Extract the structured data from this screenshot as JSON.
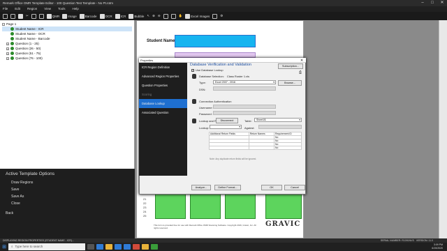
{
  "window": {
    "title": "Remark Office OMR Template Editor - 100 Question Test Template - No Pt.rotm"
  },
  "menu": [
    "File",
    "Edit",
    "Region",
    "View",
    "Tools",
    "Help"
  ],
  "toolbar": {
    "qmr": "QMR",
    "image": "Image",
    "barcode": "Barcode",
    "ocr": "OCR",
    "icr": "ICR",
    "bubble": "Bubble",
    "excel_images": "Excel Images"
  },
  "tree": {
    "root": "Page 1",
    "items": [
      {
        "label": "Student Name - ICR",
        "selected": true
      },
      {
        "label": "Student Name - OCR"
      },
      {
        "label": "Student Name - Barcode"
      },
      {
        "label": "Question (1 - 25)"
      },
      {
        "label": "Question (26 - 50)"
      },
      {
        "label": "Question (51 - 75)"
      },
      {
        "label": "Question (76 - 100)"
      }
    ]
  },
  "options": {
    "heading": "Active Template Options",
    "items": [
      "Draw Regions",
      "Save",
      "Save As",
      "Close",
      "Back"
    ]
  },
  "document": {
    "student_label": "Student Name:",
    "row_numbers": [
      "21",
      "22",
      "23",
      "24",
      "25"
    ],
    "footer": "This form is provided free for use with Remark Office OMR Scanning Software. Copyright 2016, Gravic, Inc. All rights reserved.",
    "brand": "GRAVIC"
  },
  "dialog": {
    "title": "Properties",
    "nav": [
      {
        "label": "ICR Region Definition"
      },
      {
        "label": "Advanced Region Properties"
      },
      {
        "label": "Question Properties"
      },
      {
        "label": "Scoring",
        "disabled": true
      },
      {
        "label": "Database Lookup",
        "selected": true
      },
      {
        "label": "Associated Question"
      }
    ],
    "heading": "Database Verification and Validation",
    "subscription_btn": "Subscription...",
    "use_lookup": "Use Database Lookup",
    "db_selection": {
      "label": "Database Selection:",
      "value": "Class Roster 1.xls"
    },
    "type_label": "Type:",
    "type_value": "Excel 2007 - 2016",
    "browse_btn": "Browse...",
    "dsn_label": "DSN:",
    "conn_auth": "Connection Authentication",
    "username_label": "Username:",
    "password_label": "Password:",
    "lookup_return": "Lookup and Return",
    "disconnect_btn": "Disconnect",
    "table_label": "Table:",
    "table_value": "Sheet1$",
    "lookup_label": "Lookup:",
    "against_label": "Against:",
    "ret_headers": [
      "Additional Return Fields",
      "Return Names",
      "Requirement ID"
    ],
    "ret_rows": [
      [
        "",
        "",
        "No"
      ],
      [
        "",
        "",
        "No"
      ],
      [
        "",
        "",
        "No"
      ],
      [
        "",
        "",
        "No"
      ]
    ],
    "note": "Note: Any duplicate return fields will be ignored.",
    "analyze_btn": "Analyze...",
    "define_format_btn": "Define Format...",
    "ok_btn": "OK",
    "cancel_btn": "Cancel"
  },
  "status": {
    "left": "DISPLAYING REGION PROPERTIES (STUDENT NAME - ICR)...",
    "serial": "SERIAL NUMBER: R1091NVS",
    "version": "VERSION: 11.0"
  },
  "taskbar": {
    "search_placeholder": "Type here to search",
    "time": "3:09 PM",
    "date": "6/19/2020"
  }
}
